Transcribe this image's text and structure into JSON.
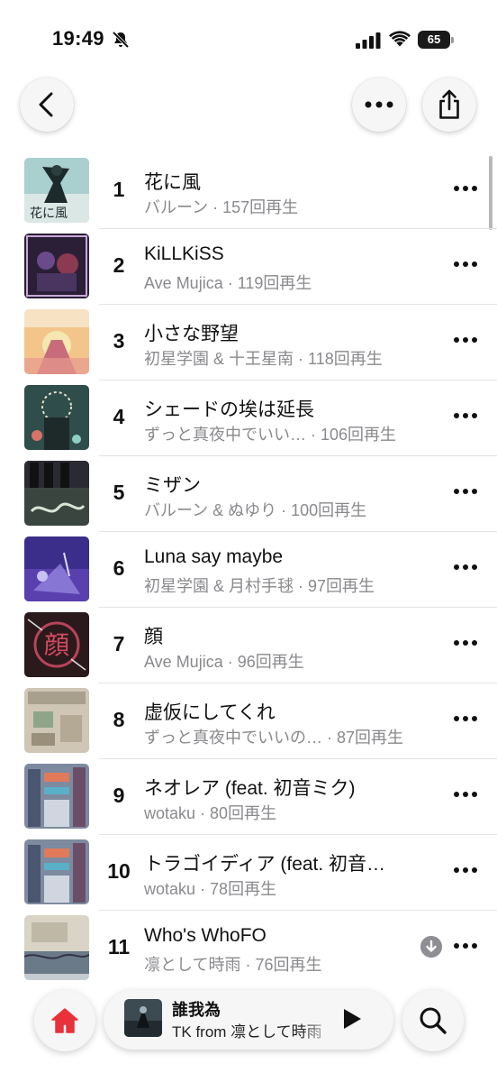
{
  "status_bar": {
    "time": "19:49",
    "battery": "65"
  },
  "tracks": [
    {
      "rank": "1",
      "title": "花に風",
      "artist": "バルーン",
      "plays": "157回再生"
    },
    {
      "rank": "2",
      "title": "KiLLKiSS",
      "artist": "Ave Mujica",
      "plays": "119回再生"
    },
    {
      "rank": "3",
      "title": "小さな野望",
      "artist": "初星学園 & 十王星南",
      "plays": "118回再生"
    },
    {
      "rank": "4",
      "title": "シェードの埃は延長",
      "artist": "ずっと真夜中でいい…",
      "plays": "106回再生"
    },
    {
      "rank": "5",
      "title": "ミザン",
      "artist": "バルーン & ぬゆり",
      "plays": "100回再生"
    },
    {
      "rank": "6",
      "title": "Luna say maybe",
      "artist": "初星学園 & 月村手毬",
      "plays": "97回再生"
    },
    {
      "rank": "7",
      "title": "顔",
      "artist": "Ave Mujica",
      "plays": "96回再生"
    },
    {
      "rank": "8",
      "title": "虚仮にしてくれ",
      "artist": "ずっと真夜中でいいの…",
      "plays": "87回再生"
    },
    {
      "rank": "9",
      "title": "ネオレア (feat. 初音ミク)",
      "artist": "wotaku",
      "plays": "80回再生"
    },
    {
      "rank": "10",
      "title": "トラゴイディア (feat. 初音…",
      "artist": "wotaku",
      "plays": "78回再生"
    },
    {
      "rank": "11",
      "title": "Who's WhoFO",
      "artist": "凛として時雨",
      "plays": "76回再生"
    }
  ],
  "subtitle_separator": " · ",
  "now_playing": {
    "title": "誰我為",
    "artist": "TK from 凛として時雨"
  },
  "colors": {
    "accent": "#e8313a",
    "secondary_text": "#8a8a8e",
    "divider": "#e3e3e6"
  }
}
